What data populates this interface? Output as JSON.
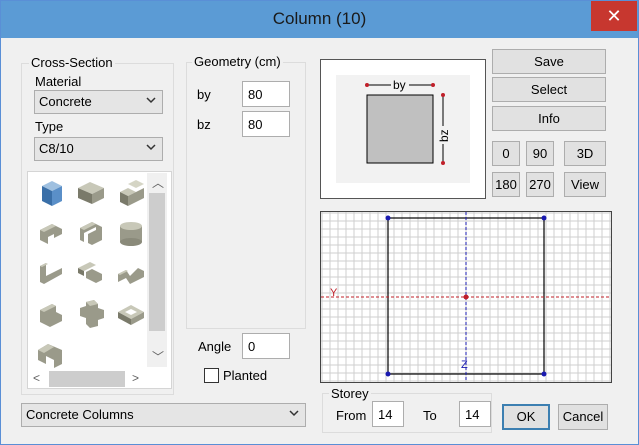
{
  "window": {
    "title": "Column (10)",
    "close_label": "✕"
  },
  "cross_section": {
    "group_label": "Cross-Section",
    "material_label": "Material",
    "material_value": "Concrete",
    "type_label": "Type",
    "type_value": "C8/10",
    "shapes": [
      "box-shape-icon",
      "l-block-shape-icon",
      "stepped-block-shape-icon",
      "c-channel-shape-icon",
      "u-channel-shape-icon",
      "cylinder-shape-icon",
      "angle-shape-icon",
      "t-shape-icon",
      "z-shape-icon",
      "l-corner-shape-icon",
      "cross-shape-icon",
      "hollow-box-shape-icon",
      "arch-shape-icon"
    ]
  },
  "geometry": {
    "group_label": "Geometry (cm)",
    "by_label": "by",
    "by_value": "80",
    "bz_label": "bz",
    "bz_value": "80"
  },
  "angle": {
    "label": "Angle",
    "value": "0"
  },
  "planted": {
    "label": "Planted",
    "checked": false
  },
  "buttons": {
    "save": "Save",
    "select": "Select",
    "info": "Info",
    "rot_0": "0",
    "rot_90": "90",
    "view_3d": "3D",
    "rot_180": "180",
    "rot_270": "270",
    "view": "View",
    "ok": "OK",
    "cancel": "Cancel"
  },
  "preview": {
    "by_label": "by",
    "bz_label": "bz"
  },
  "grid": {
    "y_axis": "Y",
    "z_axis": "Z"
  },
  "storey": {
    "group_label": "Storey",
    "from_label": "From",
    "from_value": "14",
    "to_label": "To",
    "to_value": "14"
  },
  "family": {
    "value": "Concrete Columns"
  },
  "colors": {
    "titlebar": "#5b9bd5",
    "close": "#c7372f",
    "axis_red": "#c0202a",
    "axis_blue": "#1a1ab0",
    "node_blue": "#1a1ab0"
  }
}
